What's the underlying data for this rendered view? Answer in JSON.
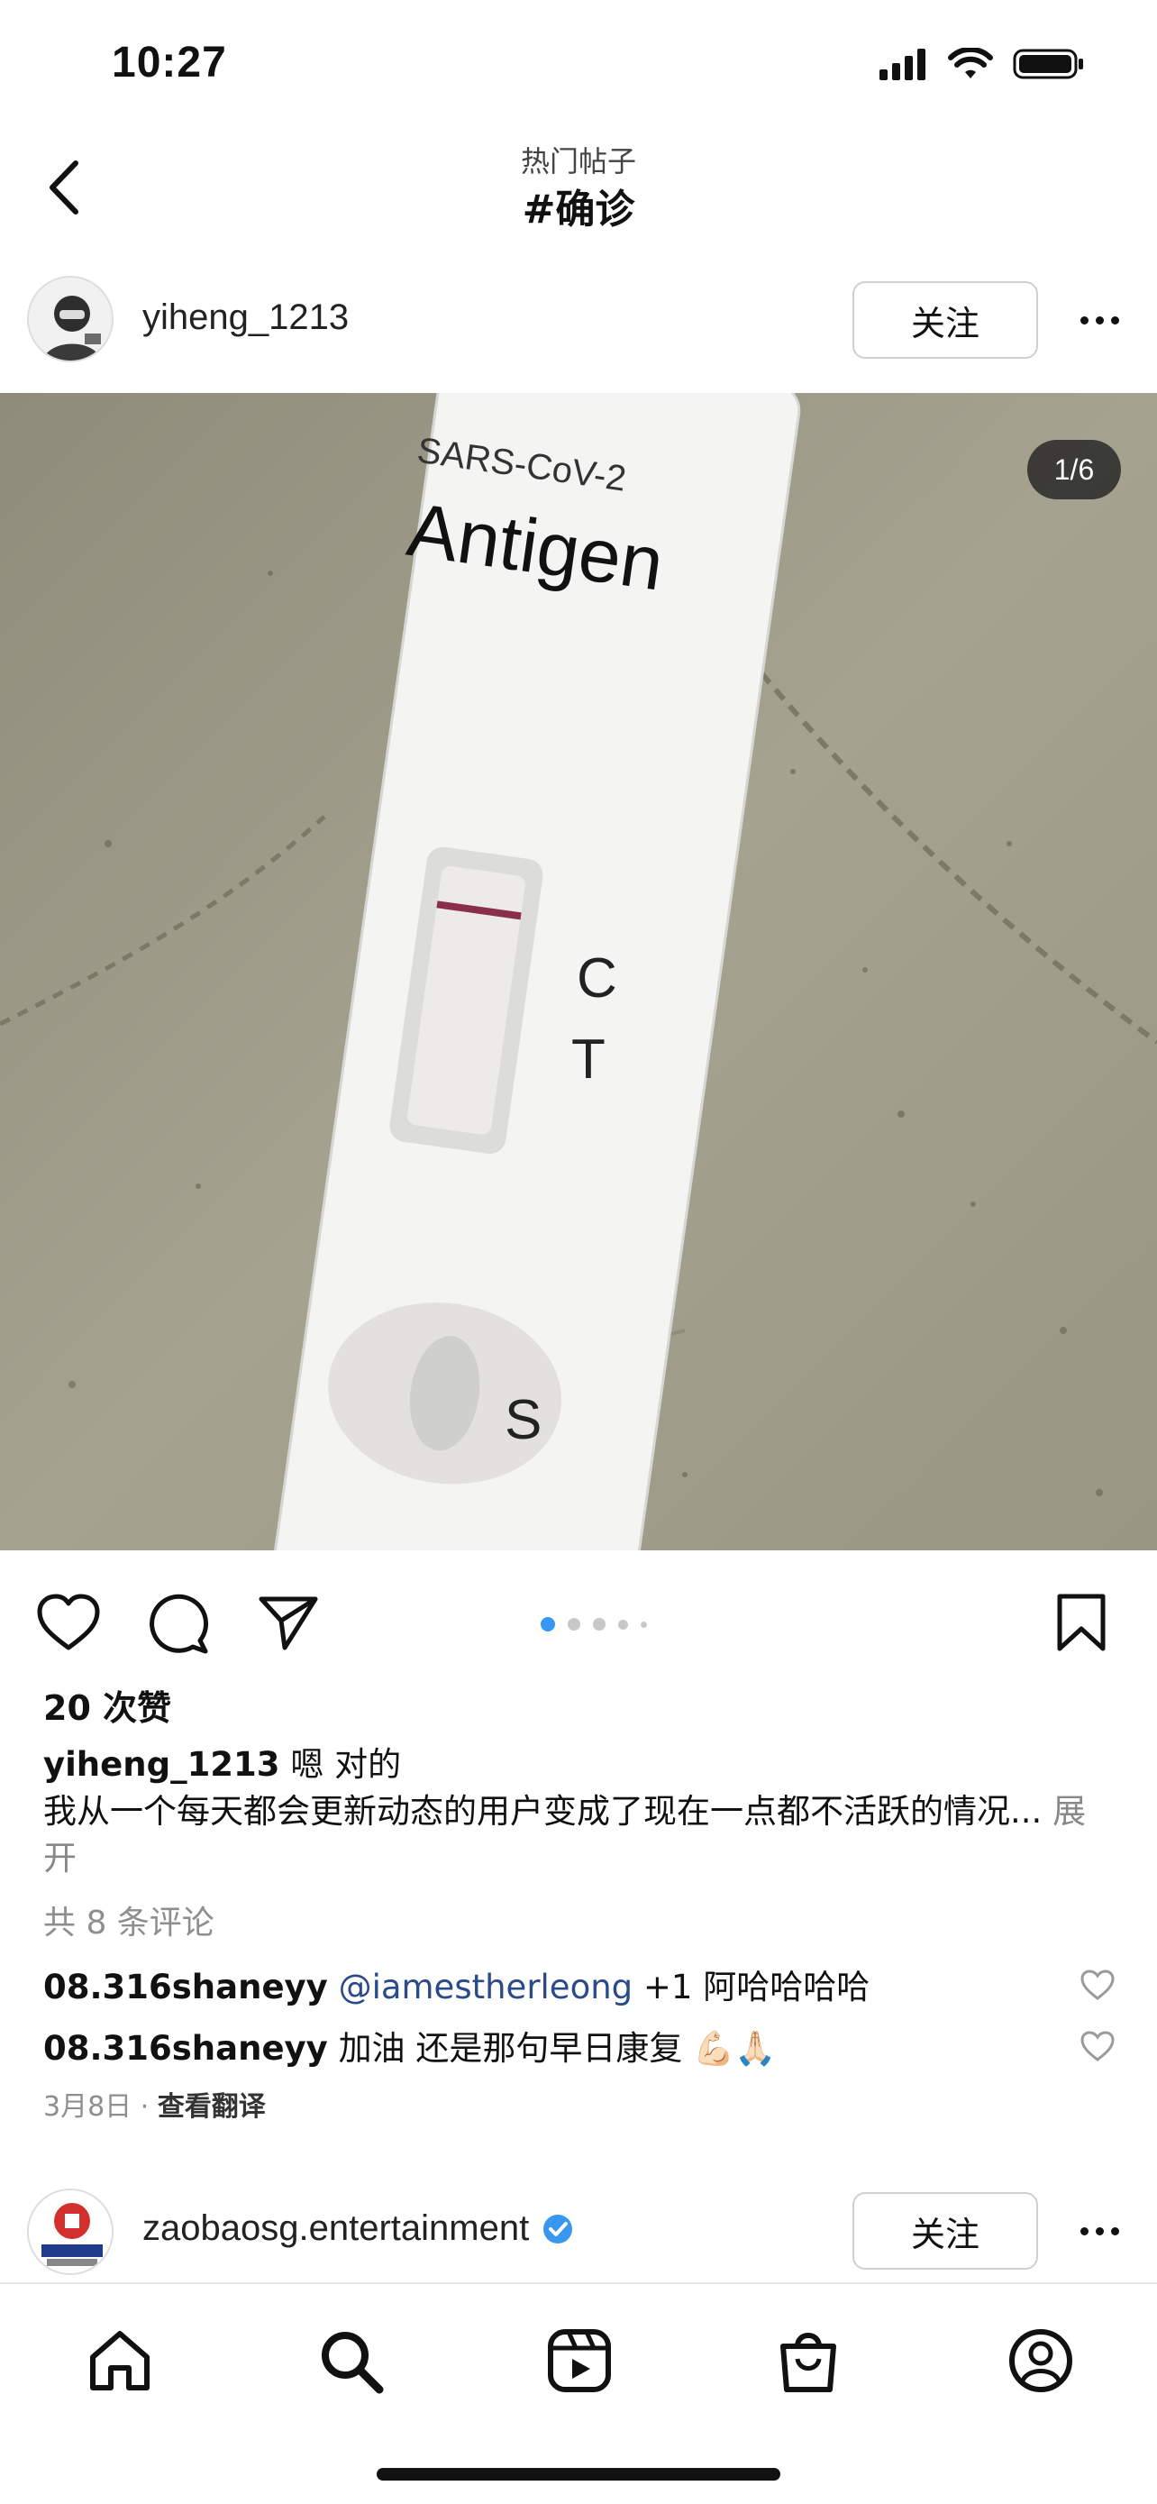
{
  "status_bar": {
    "time": "10:27"
  },
  "nav": {
    "subtitle": "热门帖子",
    "title": "#确诊",
    "back_icon": "chevron-left-icon"
  },
  "post": {
    "username": "yiheng_1213",
    "follow_label": "关注",
    "photo_counter": "1/6",
    "photo_text": {
      "line1": "SARS-CoV-2",
      "line2": "Antigen",
      "c": "C",
      "t": "T",
      "s": "S"
    },
    "likes": "20 次赞",
    "caption_user": "yiheng_1213",
    "caption_text": "嗯 对的",
    "caption_body": "我从一个每天都会更新动态的用户变成了现在一点都不活跃的情况...",
    "caption_expand": "展开",
    "comments_count": "共 8 条评论",
    "comments": [
      {
        "user": "08.316shaneyy",
        "mention": "@iamestherleong",
        "text": "+1 阿哈哈哈哈"
      },
      {
        "user": "08.316shaneyy",
        "mention": "",
        "text": "加油 还是那句早日康复 💪🏻🙏🏻"
      }
    ],
    "date": "3月8日",
    "translate": "查看翻译"
  },
  "next_post": {
    "username": "zaobaosg.entertainment",
    "follow_label": "关注"
  },
  "tabs": [
    "home-icon",
    "search-icon",
    "reels-icon",
    "shop-icon",
    "profile-icon"
  ],
  "colors": {
    "accent_blue": "#3897f0",
    "verified_blue": "#3897f0",
    "muted": "#8e8e8e"
  }
}
